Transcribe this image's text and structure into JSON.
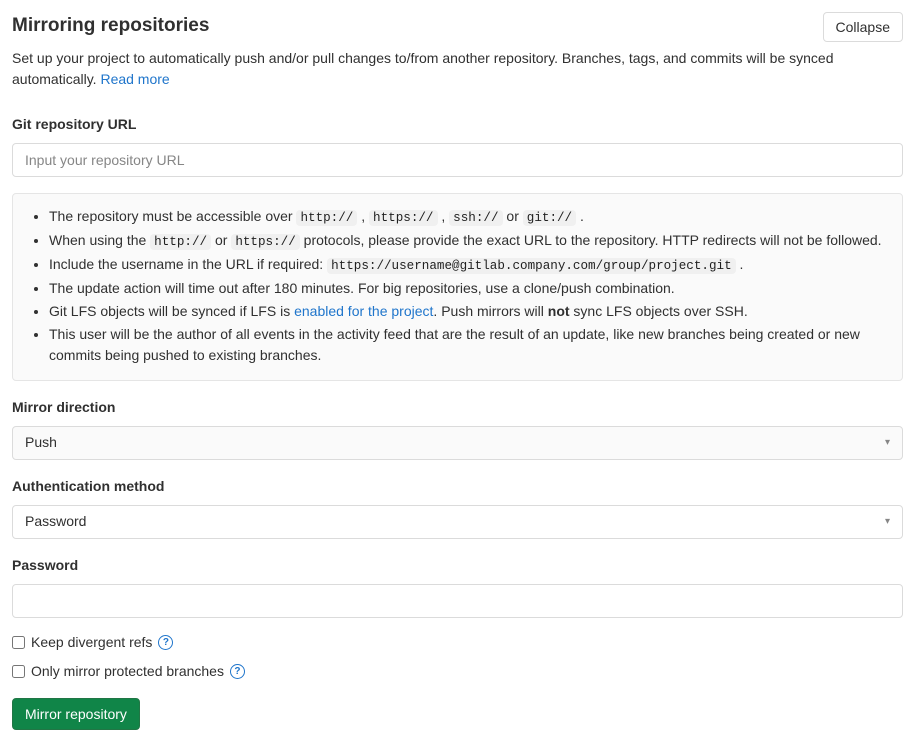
{
  "header": {
    "title": "Mirroring repositories",
    "collapse": "Collapse"
  },
  "description": {
    "text": "Set up your project to automatically push and/or pull changes to/from another repository. Branches, tags, and commits will be synced automatically. ",
    "readmore": "Read more"
  },
  "labels": {
    "repo_url": "Git repository URL",
    "mirror_direction": "Mirror direction",
    "auth_method": "Authentication method",
    "password": "Password"
  },
  "inputs": {
    "repo_url_placeholder": "Input your repository URL",
    "mirror_direction_value": "Push",
    "auth_method_value": "Password"
  },
  "info": {
    "li1_a": "The repository must be accessible over ",
    "li1_c1": "http://",
    "li1_s1": " , ",
    "li1_c2": "https://",
    "li1_s2": " , ",
    "li1_c3": "ssh://",
    "li1_s3": " or ",
    "li1_c4": "git://",
    "li1_s4": " .",
    "li2_a": "When using the ",
    "li2_c1": "http://",
    "li2_s1": " or ",
    "li2_c2": "https://",
    "li2_b": " protocols, please provide the exact URL to the repository. HTTP redirects will not be followed.",
    "li3_a": "Include the username in the URL if required: ",
    "li3_c1": "https://username@gitlab.company.com/group/project.git",
    "li3_s1": " .",
    "li4": "The update action will time out after 180 minutes. For big repositories, use a clone/push combination.",
    "li5_a": "Git LFS objects will be synced if LFS is ",
    "li5_link": "enabled for the project",
    "li5_b": ". Push mirrors will ",
    "li5_strong": "not",
    "li5_c": " sync LFS objects over SSH.",
    "li6": "This user will be the author of all events in the activity feed that are the result of an update, like new branches being created or new commits being pushed to existing branches."
  },
  "checkboxes": {
    "keep_divergent": "Keep divergent refs",
    "protected_only": "Only mirror protected branches"
  },
  "buttons": {
    "mirror": "Mirror repository"
  }
}
